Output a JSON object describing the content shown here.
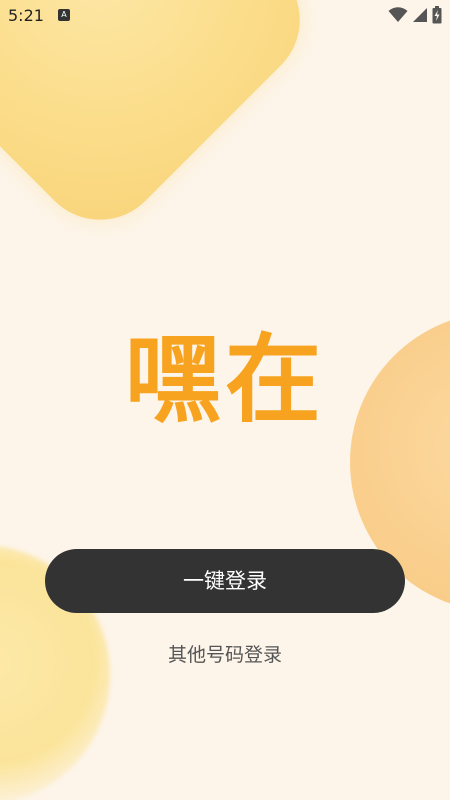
{
  "status_bar": {
    "time": "5:21",
    "notification_icon_label": "A",
    "icons": [
      "wifi-icon",
      "cellular-signal-icon",
      "battery-charging-icon"
    ]
  },
  "app": {
    "logo_text": "嘿在",
    "logo_color": "#f7a320"
  },
  "actions": {
    "one_click_login": "一键登录",
    "other_number_login": "其他号码登录"
  },
  "colors": {
    "background": "#fdf5ea",
    "button": "#333333",
    "button_text": "#ffffff"
  }
}
